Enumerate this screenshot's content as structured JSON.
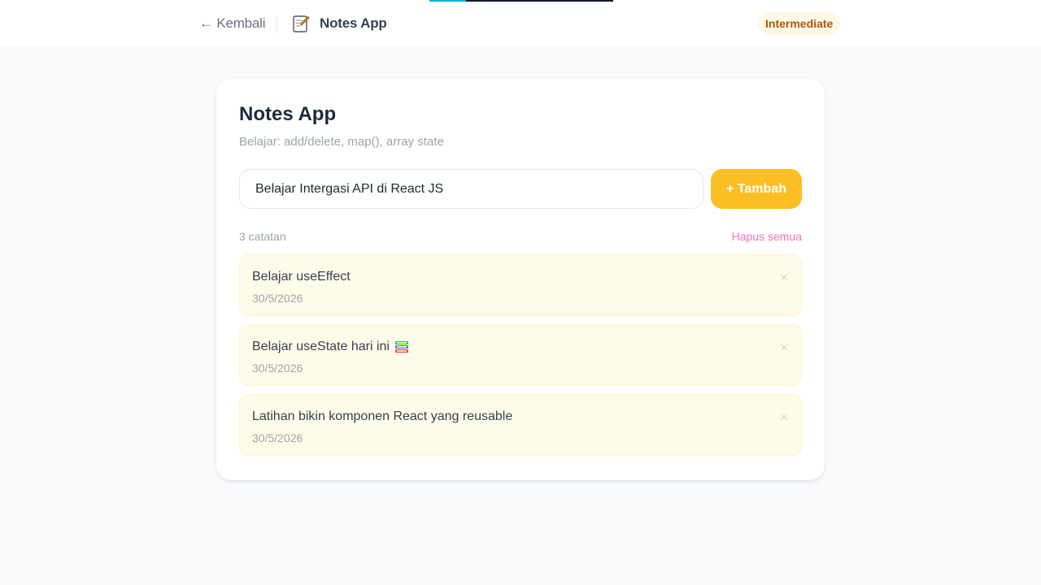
{
  "header": {
    "back_label": "← Kembali",
    "app_title": "Notes App",
    "app_icon": "memo-icon",
    "level_badge": "Intermediate",
    "progress_percent": 20
  },
  "card": {
    "title": "Notes App",
    "subtitle": "Belajar: add/delete, map(), array state",
    "input_value": "Belajar Intergasi API di React JS",
    "add_button_label": "+ Tambah",
    "count_label": "3 catatan",
    "clear_label": "Hapus semua"
  },
  "notes": [
    {
      "text": "Belajar useEffect",
      "date": "30/5/2026",
      "icon": ""
    },
    {
      "text": "Belajar useState hari ini",
      "date": "30/5/2026",
      "icon": "books-icon"
    },
    {
      "text": "Latihan bikin komponen React yang reusable",
      "date": "30/5/2026",
      "icon": ""
    }
  ],
  "colors": {
    "accent": "#fbbf24",
    "badge_text": "#b45309",
    "danger_text": "#f472b6",
    "note_bg": "#fefce8",
    "progress": "#06b6d4"
  },
  "delete_glyph": "×"
}
